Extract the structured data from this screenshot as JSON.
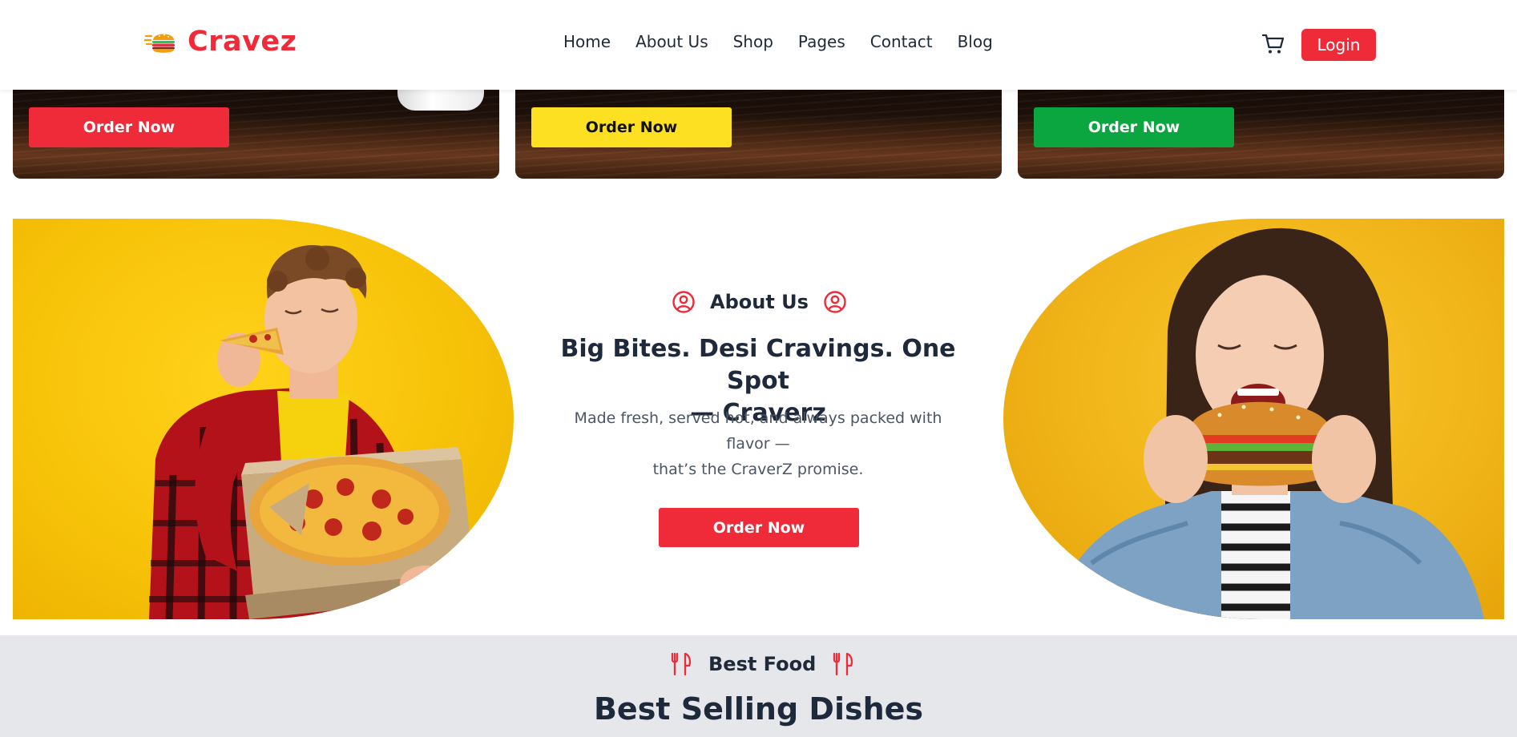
{
  "brand": {
    "name": "Cravez",
    "accent": "#ef2b3a"
  },
  "nav": {
    "items": [
      {
        "label": "Home"
      },
      {
        "label": "About Us"
      },
      {
        "label": "Shop"
      },
      {
        "label": "Pages"
      },
      {
        "label": "Contact"
      },
      {
        "label": "Blog"
      }
    ],
    "cart_icon": "cart-icon",
    "login_label": "Login"
  },
  "promos": [
    {
      "button_label": "Order Now",
      "button_color": "#ef2b3a"
    },
    {
      "button_label": "Order Now",
      "button_color": "#fde021"
    },
    {
      "button_label": "Order Now",
      "button_color": "#0ba640"
    }
  ],
  "about": {
    "tag": "About Us",
    "tag_icon": "user-circle-icon",
    "title_line1": "Big Bites. Desi Cravings. One Spot",
    "title_line2": "— Craverz",
    "desc_line1": "Made fresh, served hot, and always packed with",
    "desc_line2": "flavor —",
    "desc_line3": "that’s the CraverZ promise.",
    "button_label": "Order Now"
  },
  "best": {
    "tag": "Best Food",
    "tag_icon": "fork-knife-icon",
    "title": "Best Selling Dishes"
  },
  "colors": {
    "yellow_bg": "#f7c309",
    "section_gray": "#e5e7eb"
  }
}
